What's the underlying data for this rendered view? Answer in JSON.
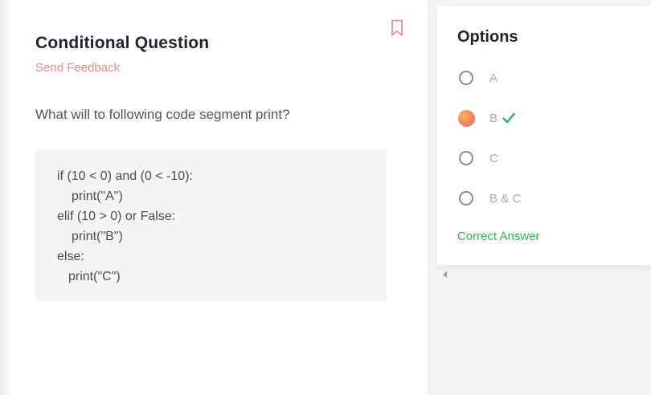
{
  "question": {
    "title": "Conditional Question",
    "feedback_label": "Send Feedback",
    "prompt": "What will to following code segment print?",
    "code_lines": [
      "if (10 < 0) and (0 < -10):",
      "print(\"A\")",
      "elif (10 > 0) or False:",
      "print(\"B\")",
      "else:",
      "print(\"C\")"
    ]
  },
  "options": {
    "title": "Options",
    "items": [
      {
        "label": "A",
        "selected": false
      },
      {
        "label": "B",
        "selected": true,
        "correct": true
      },
      {
        "label": "C",
        "selected": false
      },
      {
        "label": "B & C",
        "selected": false
      }
    ],
    "result_text": "Correct Answer"
  },
  "icons": {
    "bookmark": "bookmark-icon",
    "check": "check-icon",
    "scroll_left": "chevron-left-icon"
  },
  "colors": {
    "accent_pink": "#f08f8f",
    "correct_green": "#34b55a",
    "title_dark": "#1f2330"
  }
}
